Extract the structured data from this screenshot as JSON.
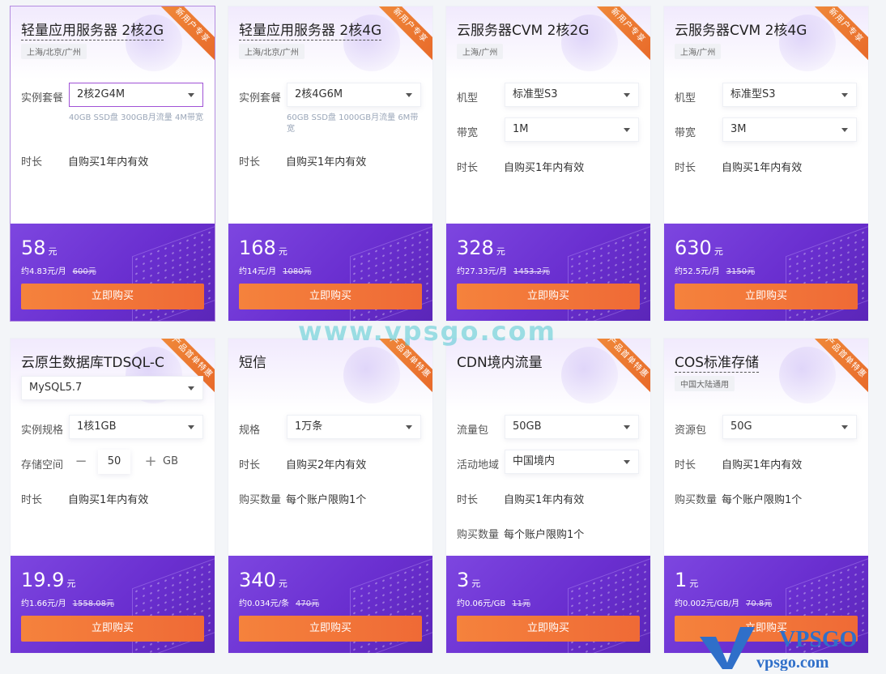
{
  "accent": "#7d46e0",
  "buy_color": "#f5823c",
  "cards": [
    {
      "title": "轻量应用服务器 2核2G",
      "ribbon": "新用户专享",
      "region": "上海/北京/广州",
      "rows": [
        {
          "label": "实例套餐",
          "select": "2核2G4M",
          "hint": "40GB SSD盘 300GB月流量 4M带宽"
        },
        {
          "label": "时长",
          "value": "自购买1年内有效"
        }
      ],
      "price": "58",
      "unit": "元",
      "monthly": "约4.83元/月",
      "original": "600元",
      "buy": "立即购买"
    },
    {
      "title": "轻量应用服务器 2核4G",
      "ribbon": "新用户专享",
      "region": "上海/北京/广州",
      "rows": [
        {
          "label": "实例套餐",
          "select": "2核4G6M",
          "hint": "60GB SSD盘 1000GB月流量 6M带宽"
        },
        {
          "label": "时长",
          "value": "自购买1年内有效"
        }
      ],
      "price": "168",
      "unit": "元",
      "monthly": "约14元/月",
      "original": "1080元",
      "buy": "立即购买"
    },
    {
      "title": "云服务器CVM 2核2G",
      "ribbon": "新用户专享",
      "region": "上海/广州",
      "rows": [
        {
          "label": "机型",
          "select": "标准型S3"
        },
        {
          "label": "带宽",
          "select": "1M"
        },
        {
          "label": "时长",
          "value": "自购买1年内有效"
        }
      ],
      "price": "328",
      "unit": "元",
      "monthly": "约27.33元/月",
      "original": "1453.2元",
      "buy": "立即购买"
    },
    {
      "title": "云服务器CVM 2核4G",
      "ribbon": "新用户专享",
      "region": "上海/广州",
      "rows": [
        {
          "label": "机型",
          "select": "标准型S3"
        },
        {
          "label": "带宽",
          "select": "3M"
        },
        {
          "label": "时长",
          "value": "自购买1年内有效"
        }
      ],
      "price": "630",
      "unit": "元",
      "monthly": "约52.5元/月",
      "original": "3150元",
      "buy": "立即购买"
    },
    {
      "title": "云原生数据库TDSQL-C",
      "ribbon": "产品首单特惠",
      "top_select": "MySQL5.7",
      "rows": [
        {
          "label": "实例规格",
          "select": "1核1GB"
        },
        {
          "label": "存储空间",
          "stepper": {
            "minus": "−",
            "value": "50",
            "plus": "+",
            "unit": "GB"
          }
        },
        {
          "label": "时长",
          "value": "自购买1年内有效"
        }
      ],
      "price": "19.9",
      "unit": "元",
      "monthly": "约1.66元/月",
      "original": "1558.08元",
      "buy": "立即购买"
    },
    {
      "title": "短信",
      "ribbon": "产品首单特惠",
      "rows": [
        {
          "label": "规格",
          "select": "1万条"
        },
        {
          "label": "时长",
          "value": "自购买2年内有效"
        },
        {
          "label": "购买数量",
          "value": "每个账户限购1个"
        }
      ],
      "price": "340",
      "unit": "元",
      "monthly": "约0.034元/条",
      "original": "470元",
      "buy": "立即购买"
    },
    {
      "title": "CDN境内流量",
      "ribbon": "产品首单特惠",
      "rows": [
        {
          "label": "流量包",
          "select": "50GB"
        },
        {
          "label": "活动地域",
          "select": "中国境内"
        },
        {
          "label": "时长",
          "value": "自购买1年内有效"
        },
        {
          "label": "购买数量",
          "value": "每个账户限购1个"
        }
      ],
      "price": "3",
      "unit": "元",
      "monthly": "约0.06元/GB",
      "original": "11元",
      "buy": "立即购买"
    },
    {
      "title": "COS标准存储",
      "ribbon": "产品首单特惠",
      "region": "中国大陆通用",
      "rows": [
        {
          "label": "资源包",
          "select": "50G"
        },
        {
          "label": "时长",
          "value": "自购买1年内有效"
        },
        {
          "label": "购买数量",
          "value": "每个账户限购1个"
        }
      ],
      "price": "1",
      "unit": "元",
      "monthly": "约0.002元/GB/月",
      "original": "70.8元",
      "buy": "立即购买"
    }
  ],
  "watermark": "www.vpsgo.com",
  "logo": {
    "brand": "VPSGO",
    "site": "vpsgo.com"
  }
}
